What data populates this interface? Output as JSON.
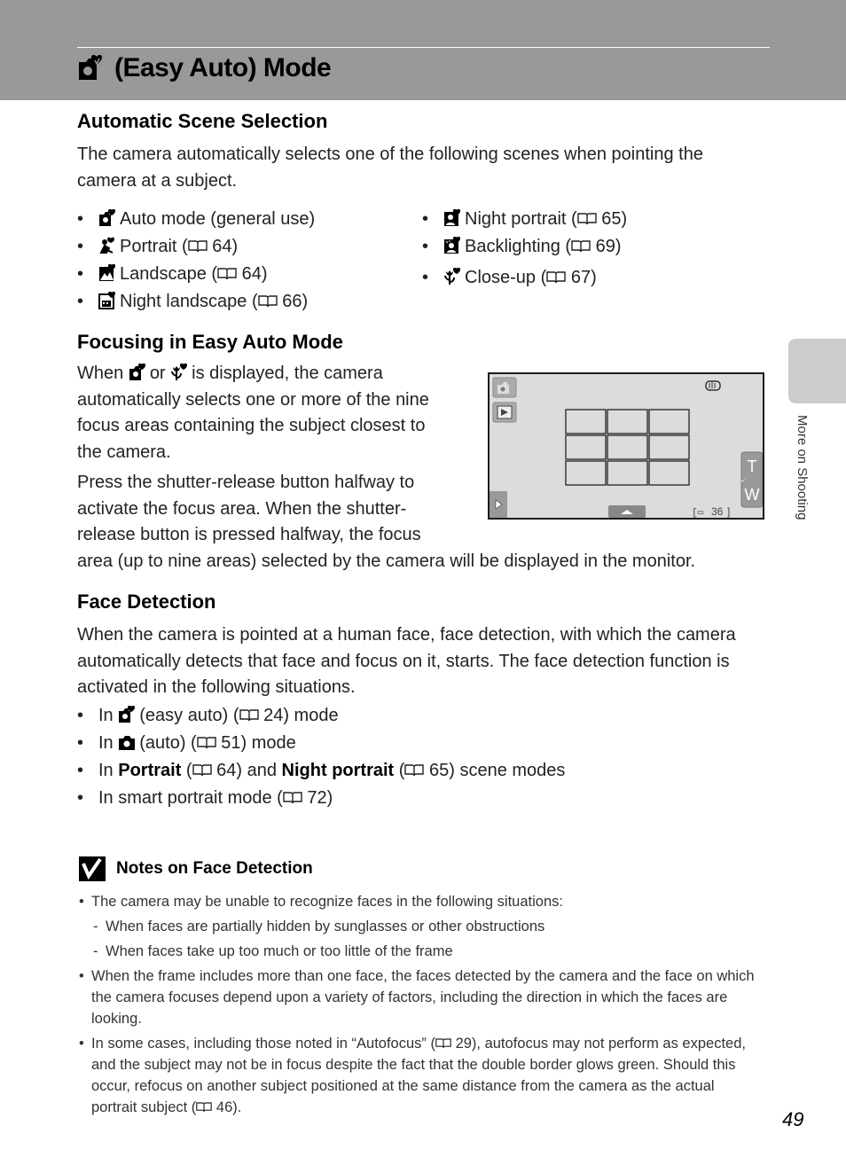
{
  "header": {
    "title": "(Easy Auto) Mode",
    "title_icon": "easy-auto-camera-icon",
    "band_color": "#999999"
  },
  "side_tab": {
    "label": "More on Shooting"
  },
  "sections": {
    "auto_scene": {
      "heading": "Automatic Scene Selection",
      "intro": "The camera automatically selects one of the following scenes when pointing the camera at a subject.",
      "left_items": [
        {
          "icon": "easy-auto-icon",
          "label": "Auto mode (general use)",
          "ref": ""
        },
        {
          "icon": "portrait-icon",
          "label": "Portrait (",
          "ref": "64)"
        },
        {
          "icon": "landscape-icon",
          "label": "Landscape (",
          "ref": "64)"
        },
        {
          "icon": "night-landscape-icon",
          "label": "Night landscape (",
          "ref": "66)"
        }
      ],
      "right_items": [
        {
          "icon": "night-portrait-icon",
          "label": "Night portrait (",
          "ref": "65)"
        },
        {
          "icon": "backlighting-icon",
          "label": "Backlighting (",
          "ref": "69)"
        },
        {
          "icon": "close-up-icon",
          "label": "Close-up (",
          "ref": "67)"
        }
      ]
    },
    "focusing": {
      "heading": "Focusing in Easy Auto Mode",
      "p1_a": "When",
      "p1_b": "or",
      "p1_c": "is displayed, the camera",
      "p1_lines": [
        "automatically selects one or more of the nine",
        "focus areas containing the subject closest to",
        "the camera."
      ],
      "p2_lines": [
        "Press the shutter-release button halfway to",
        "activate the focus area. When the shutter-",
        "release button is pressed halfway, the focus",
        "area (up to nine areas) selected by the camera will be displayed in the monitor."
      ],
      "screen": {
        "zoom_t": "T",
        "zoom_w": "W",
        "exposures_remaining": "36",
        "focus_grid": {
          "rows": 3,
          "cols": 3
        }
      }
    },
    "face_detection": {
      "heading": "Face Detection",
      "intro": "When the camera is pointed at a human face, face detection, with which the camera automatically detects that face and focus on it, starts. The face detection function is activated in the following situations.",
      "items": [
        {
          "pre": "In",
          "icon": "easy-auto-icon",
          "mid": "(easy auto) (",
          "ref": "24) mode"
        },
        {
          "pre": "In",
          "icon": "auto-camera-icon",
          "mid": "(auto) (",
          "ref": "51) mode"
        },
        {
          "pre": "In",
          "bold1": "Portrait",
          "mid1": " (",
          "ref1": "64) and ",
          "bold2": "Night portrait",
          "mid2": " (",
          "ref2": "65) scene modes"
        },
        {
          "pre": "In smart portrait mode (",
          "ref": "72)"
        }
      ]
    },
    "notes": {
      "heading": "Notes on Face Detection",
      "items": [
        {
          "text": "The camera may be unable to recognize faces in the following situations:",
          "sub": [
            "When faces are partially hidden by sunglasses or other obstructions",
            "When faces take up too much or too little of the frame"
          ]
        },
        {
          "text": "When the frame includes more than one face, the faces detected by the camera and the face on which the camera focuses depend upon a variety of factors, including the direction in which the faces are looking."
        },
        {
          "text_a": "In some cases, including those noted in “Autofocus” (",
          "ref_a": "29), autofocus may not perform as expected, and the subject may not be in focus despite the fact that the double border glows green. Should this occur, refocus on another subject positioned at the same distance from the camera as the actual portrait subject (",
          "ref_b": "46)."
        }
      ]
    }
  },
  "page_number": "49"
}
